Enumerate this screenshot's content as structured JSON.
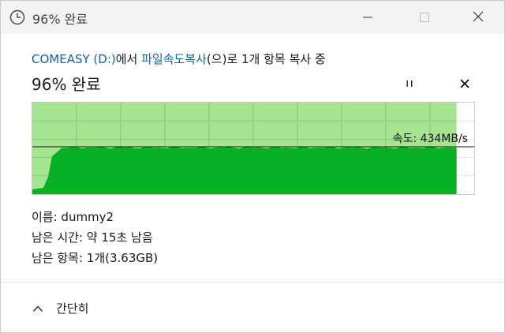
{
  "titlebar": {
    "title": "96% 완료"
  },
  "header": {
    "source_drive": "COMEASY (D:)",
    "source_suffix": "에서 ",
    "destination": "파일속도복사",
    "destination_suffix": "(으)로 1개 항목 복사 중"
  },
  "status": {
    "title": "96% 완료",
    "progress_percent": 96
  },
  "graph": {
    "speed_label": "속도: 434MB/s",
    "fill_color": "#06b025",
    "progress_color": "#a6e590",
    "grid_color": "#82c47a"
  },
  "details": {
    "name": "이름: dummy2",
    "time_remaining": "남은 시간: 약 15초 남음",
    "items_remaining": "남은 항목: 1개(3.63GB)"
  },
  "footer": {
    "collapse_label": "간단히"
  }
}
